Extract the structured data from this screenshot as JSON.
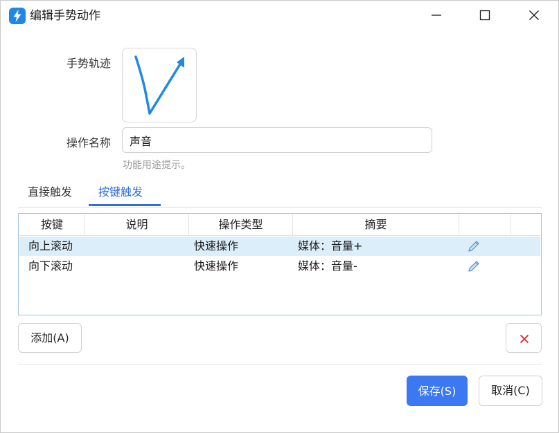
{
  "window": {
    "title": "编辑手势动作",
    "controls": {
      "minimize": "minimize-icon",
      "maximize": "maximize-icon",
      "close": "close-icon"
    }
  },
  "form": {
    "gesture_label": "手势轨迹",
    "name_label": "操作名称",
    "name_value": "声音",
    "hint": "功能用途提示。"
  },
  "tabs": [
    {
      "label": "直接触发",
      "active": false
    },
    {
      "label": "按键触发",
      "active": true
    }
  ],
  "table": {
    "columns": [
      "按键",
      "说明",
      "操作类型",
      "摘要",
      "",
      ""
    ],
    "rows": [
      {
        "key": "向上滚动",
        "desc": "",
        "type": "快速操作",
        "summary": "媒体：音量+",
        "selected": true
      },
      {
        "key": "向下滚动",
        "desc": "",
        "type": "快速操作",
        "summary": "媒体：音量-",
        "selected": false
      }
    ]
  },
  "buttons": {
    "add": "添加(A)",
    "delete_icon": "delete-x-icon",
    "save": "保存(S)",
    "cancel": "取消(C)"
  },
  "colors": {
    "accent": "#3b78f2",
    "tab_active": "#2f6fe0",
    "selected_row": "#dbeef9",
    "delete_red": "#e53935",
    "gesture_stroke": "#1e88e5"
  }
}
